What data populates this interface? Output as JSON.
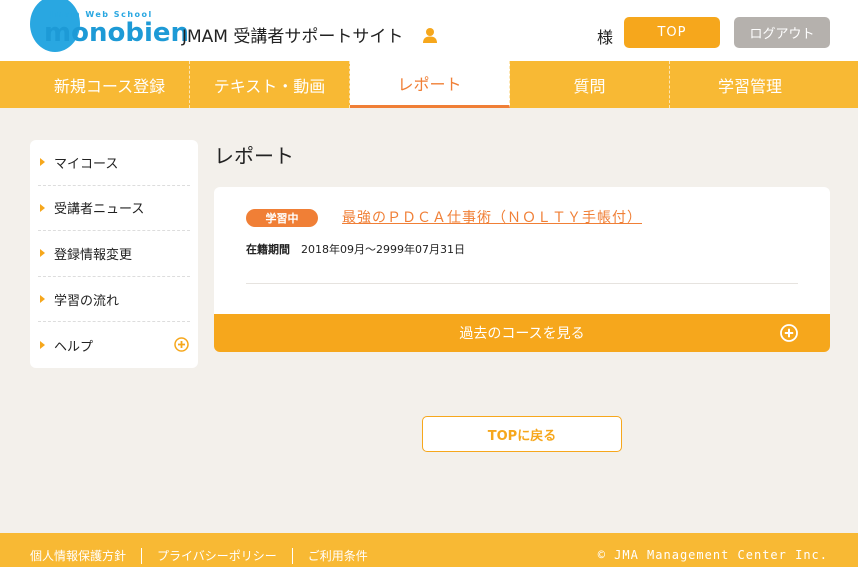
{
  "header": {
    "logo_small": "Jmam Web School",
    "logo_main": "monobien",
    "site_title": "JMAM 受講者サポートサイト",
    "user_icon": "person-icon",
    "honorific": "様",
    "top_label": "TOP",
    "logout_label": "ログアウト"
  },
  "nav": {
    "items": [
      {
        "label": "新規コース登録"
      },
      {
        "label": "テキスト・動画"
      },
      {
        "label": "レポート"
      },
      {
        "label": "質問"
      },
      {
        "label": "学習管理"
      }
    ],
    "active": "レポート"
  },
  "sidebar": {
    "items": [
      {
        "label": "マイコース"
      },
      {
        "label": "受講者ニュース"
      },
      {
        "label": "登録情報変更"
      },
      {
        "label": "学習の流れ"
      },
      {
        "label": "ヘルプ"
      }
    ]
  },
  "main": {
    "page_title": "レポート",
    "course": {
      "status": "学習中",
      "title": "最強のＰＤＣＡ仕事術（ＮＯＬＴＹ手帳付）",
      "period_label": "在籍期間",
      "period_value": "2018年09月～2999年07月31日"
    },
    "past_courses_label": "過去のコースを見る",
    "back_top_label": "TOPに戻る"
  },
  "footer": {
    "links": [
      "個人情報保護方針",
      "プライバシーポリシー",
      "ご利用条件"
    ],
    "copyright": "© JMA Management Center Inc."
  },
  "colors": {
    "accent": "#f6a71c",
    "nav_bg": "#f8b934",
    "active_text": "#f07f36",
    "logo_blue": "#29a7e1",
    "page_bg": "#f3f0eb"
  }
}
